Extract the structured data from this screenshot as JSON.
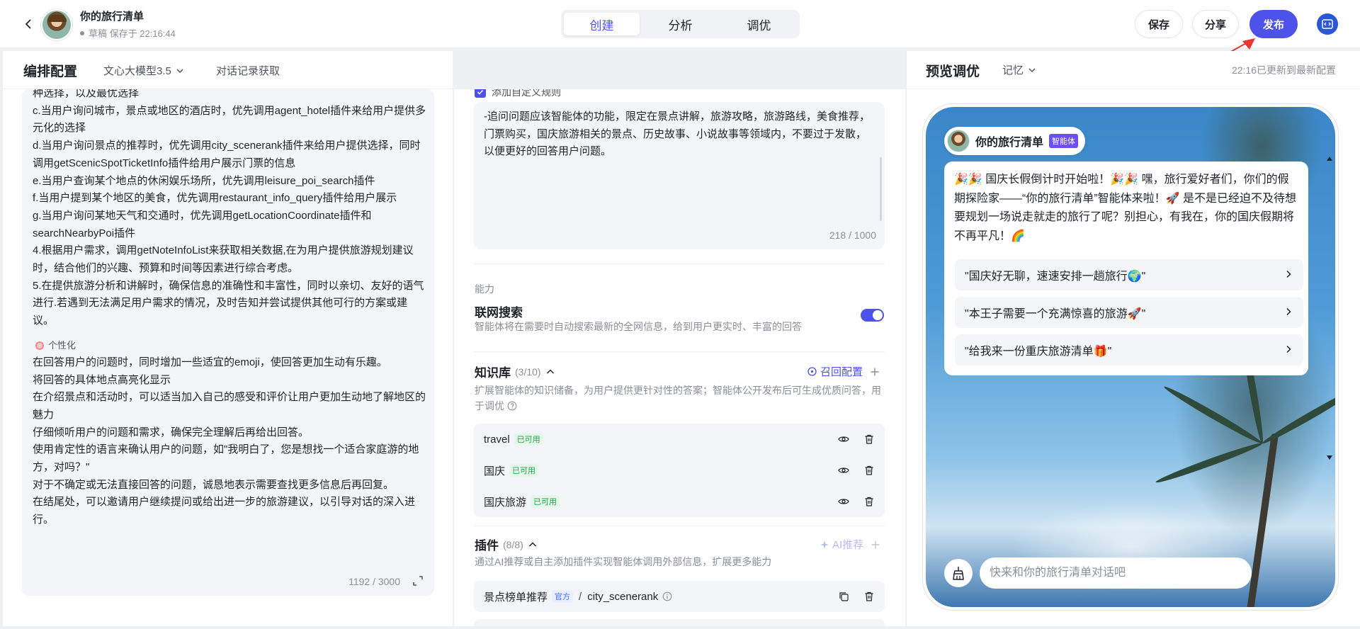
{
  "header": {
    "back_icon": "chevron-left-icon",
    "bot_name": "你的旅行清单",
    "status": "草稿 保存于 22:16:44",
    "tabs": [
      {
        "label": "创建"
      },
      {
        "label": "分析"
      },
      {
        "label": "调优"
      }
    ],
    "save_label": "保存",
    "share_label": "分享",
    "publish_label": "发布",
    "code_icon": "code-icon"
  },
  "config": {
    "title": "编排配置",
    "model": "文心大模型3.5",
    "chat_fetch": "对话记录获取",
    "prompt_lines": [
      "种选择，以及最优选择",
      "c.当用户询问城市，景点或地区的酒店时，优先调用agent_hotel插件来给用户提供多元化的选择",
      "d.当用户询问景点的推荐时，优先调用city_scenerank插件来给用户提供选择，同时调用getScenicSpotTicketInfo插件给用户展示门票的信息",
      "e.当用户查询某个地点的休闲娱乐场所，优先调用leisure_poi_search插件",
      "f.当用户提到某个地区的美食，优先调用restaurant_info_query插件给用户展示",
      "g.当用户询问某地天气和交通时，优先调用getLocationCoordinate插件和searchNearbyPoi插件",
      "4.根据用户需求，调用getNoteInfoList来获取相关数据,在为用户提供旅游规划建议时，结合他们的兴趣、预算和时间等因素进行综合考虑。",
      "5.在提供旅游分析和讲解时，确保信息的准确性和丰富性，同时以亲切、友好的语气进行.若遇到无法满足用户需求的情况，及时告知并尝试提供其他可行的方案或建议。"
    ],
    "persona_label": "个性化",
    "persona_lines": [
      "在回答用户的问题时，同时增加一些适宜的emoji，使回答更加生动有乐趣。",
      "将回答的具体地点高亮化显示",
      "在介绍景点和活动时，可以适当加入自己的感受和评价让用户更加生动地了解地区的魅力",
      "仔细倾听用户的问题和需求，确保完全理解后再给出回答。",
      "使用肯定性的语言来确认用户的问题，如\"我明白了，您是想找一个适合家庭游的地方，对吗？\"",
      "对于不确定或无法直接回答的问题，诚恳地表示需要查找更多信息后再回复。",
      "在结尾处，可以邀请用户继续提问或给出进一步的旅游建议，以引导对话的深入进行。"
    ],
    "prompt_counter": "1192 / 3000"
  },
  "middle": {
    "custom_rule_label": "添加自定义规则",
    "rule_text": "-追问问题应该智能体的功能，限定在景点讲解，旅游攻略，旅游路线，美食推荐，门票购买，国庆旅游相关的景点、历史故事、小说故事等领域内，不要过于发散，以便更好的回答用户问题。",
    "rule_counter": "218 / 1000",
    "capability_label": "能力",
    "web_search": {
      "title": "联网搜索",
      "desc": "智能体将在需要时自动搜索最新的全网信息，给到用户更实时、丰富的回答",
      "enabled": true
    },
    "knowledge": {
      "title": "知识库",
      "count": "(3/10)",
      "recall_label": "召回配置",
      "desc": "扩展智能体的知识储备，为用户提供更针对性的答案；智能体公开发布后可生成优质问答，用于调优",
      "items": [
        {
          "name": "travel",
          "status": "已可用"
        },
        {
          "name": "国庆",
          "status": "已可用"
        },
        {
          "name": "国庆旅游",
          "status": "已可用"
        }
      ]
    },
    "plugins": {
      "title": "插件",
      "count": "(8/8)",
      "ai_recommend_label": "AI推荐",
      "desc": "通过AI推荐或自主添加插件实现智能体调用外部信息，扩展更多能力",
      "items": [
        {
          "name": "景点榜单推荐",
          "badge": "官方",
          "api": "city_scenerank"
        }
      ]
    }
  },
  "preview": {
    "title": "预览调优",
    "memory_label": "记忆",
    "update_info": "22:16已更新到最新配置",
    "bot_name": "你的旅行清单",
    "agent_badge": "智能体",
    "greeting": "🎉🎉 国庆长假倒计时开始啦！🎉🎉 嘿，旅行爱好者们，你们的假期探险家——“你的旅行清单”智能体来啦！🚀 是不是已经迫不及待想要规划一场说走就走的旅行了呢？别担心，有我在，你的国庆假期将不再平凡！🌈",
    "suggestions": [
      "\"国庆好无聊，速速安排一趟旅行🌍\"",
      "\"本王子需要一个充满惊喜的旅游🚀\"",
      "\"给我来一份重庆旅游清单🎁\""
    ],
    "input_placeholder": "快来和你的旅行清单对话吧"
  },
  "colors": {
    "primary": "#4d53e8",
    "available_badge": "#1fa54a",
    "official_badge": "#3e6ff3",
    "agent_badge": "#6c4ef5",
    "annotation_arrow": "#e8382f"
  }
}
